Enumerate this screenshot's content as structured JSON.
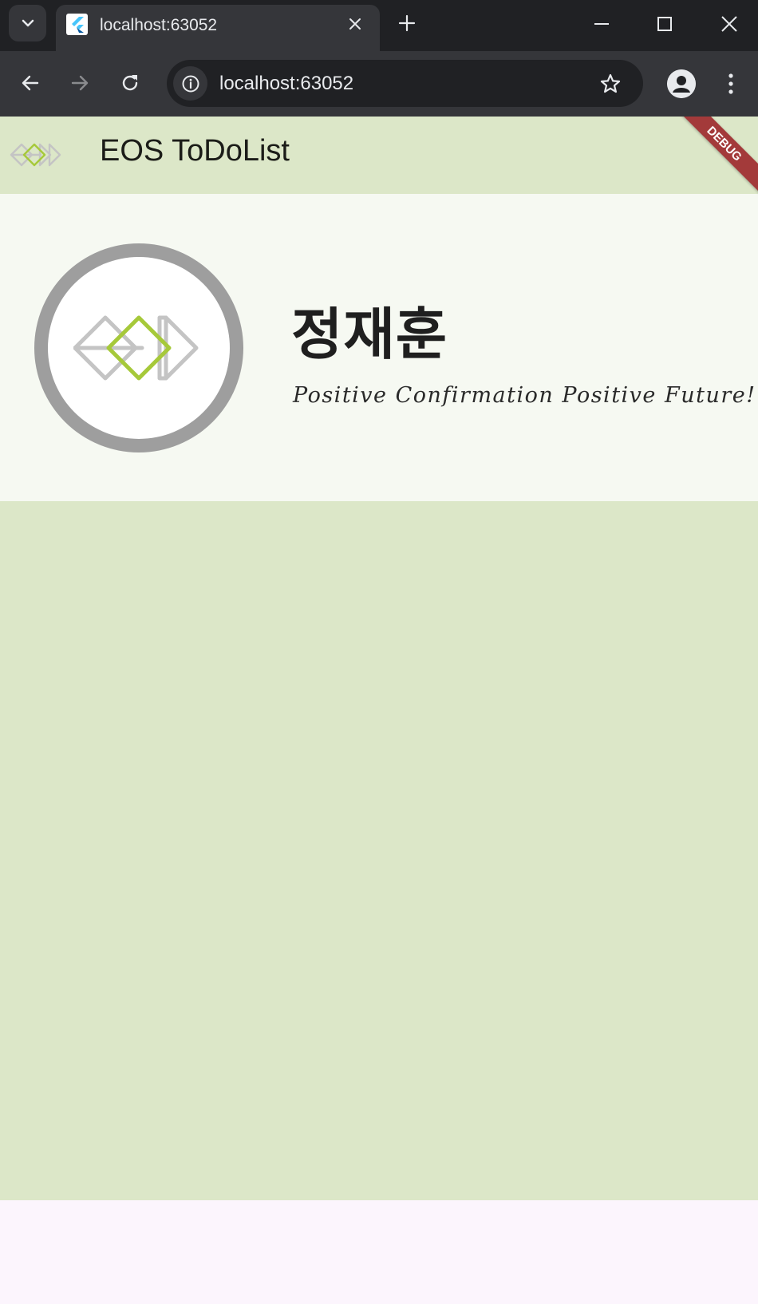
{
  "browser": {
    "tab_title": "localhost:63052",
    "url": "localhost:63052"
  },
  "app": {
    "title": "EOS ToDoList",
    "debug_label": "DEBUG",
    "colors": {
      "appbar_bg": "#dce7c8",
      "profile_bg": "#f6f9f2",
      "content_bg": "#dce7c8",
      "page_bg": "#fcf5fd",
      "logo_green": "#a6c93a",
      "logo_gray": "#c4c4c4",
      "avatar_ring": "#9e9e9e",
      "debug_banner": "#a33a3a"
    }
  },
  "profile": {
    "name": "정재훈",
    "motto": "Positive Confirmation Positive Future!"
  }
}
